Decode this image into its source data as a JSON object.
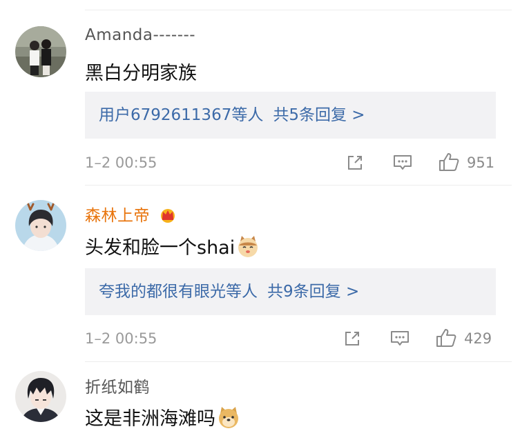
{
  "comments": [
    {
      "username": "Amanda-------",
      "text": "黑白分明家族",
      "reply_summary": {
        "users": "用户6792611367等人",
        "count": "共5条回复 >"
      },
      "time": "1–2 00:55",
      "like_count": "951",
      "avatar": "couple-photo-avatar"
    },
    {
      "username": "森林上帝",
      "text": "头发和脸一个shai",
      "emoji": "cat-face-emoji",
      "badge": "crown-badge-icon",
      "reply_summary": {
        "users": "夸我的都很有眼光等人",
        "count": "共9条回复 >"
      },
      "time": "1–2 00:55",
      "like_count": "429",
      "avatar": "antler-person-avatar"
    },
    {
      "username": "折纸如鹤",
      "text": "这是非洲海滩吗",
      "emoji": "doge-emoji",
      "avatar": "anime-boy-avatar"
    }
  ],
  "colors": {
    "link_blue": "#3c6aa8",
    "vip_orange": "#e8740c",
    "meta_gray": "#9a9a9a",
    "reply_bg": "#f2f2f4"
  },
  "icons": [
    "share-icon",
    "comment-icon",
    "like-icon"
  ]
}
